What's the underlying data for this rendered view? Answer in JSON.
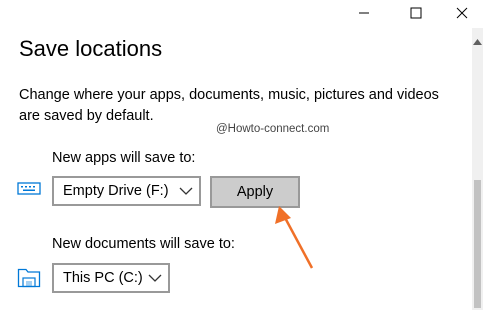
{
  "window": {
    "minimize_icon": "minimize-icon",
    "maximize_icon": "maximize-icon",
    "close_icon": "close-icon"
  },
  "page": {
    "title": "Save locations",
    "description": "Change where your apps, documents, music, pictures and videos are saved by default."
  },
  "watermark": "@Howto-connect.com",
  "apps": {
    "label": "New apps will save to:",
    "selected": "Empty Drive (F:)",
    "apply_label": "Apply",
    "icon": "keyboard-icon"
  },
  "documents": {
    "label": "New documents will save to:",
    "selected": "This PC (C:)",
    "icon": "folder-icon"
  },
  "colors": {
    "accent": "#0078d7",
    "arrow": "#f07028",
    "apply_bg": "#cccccc"
  }
}
